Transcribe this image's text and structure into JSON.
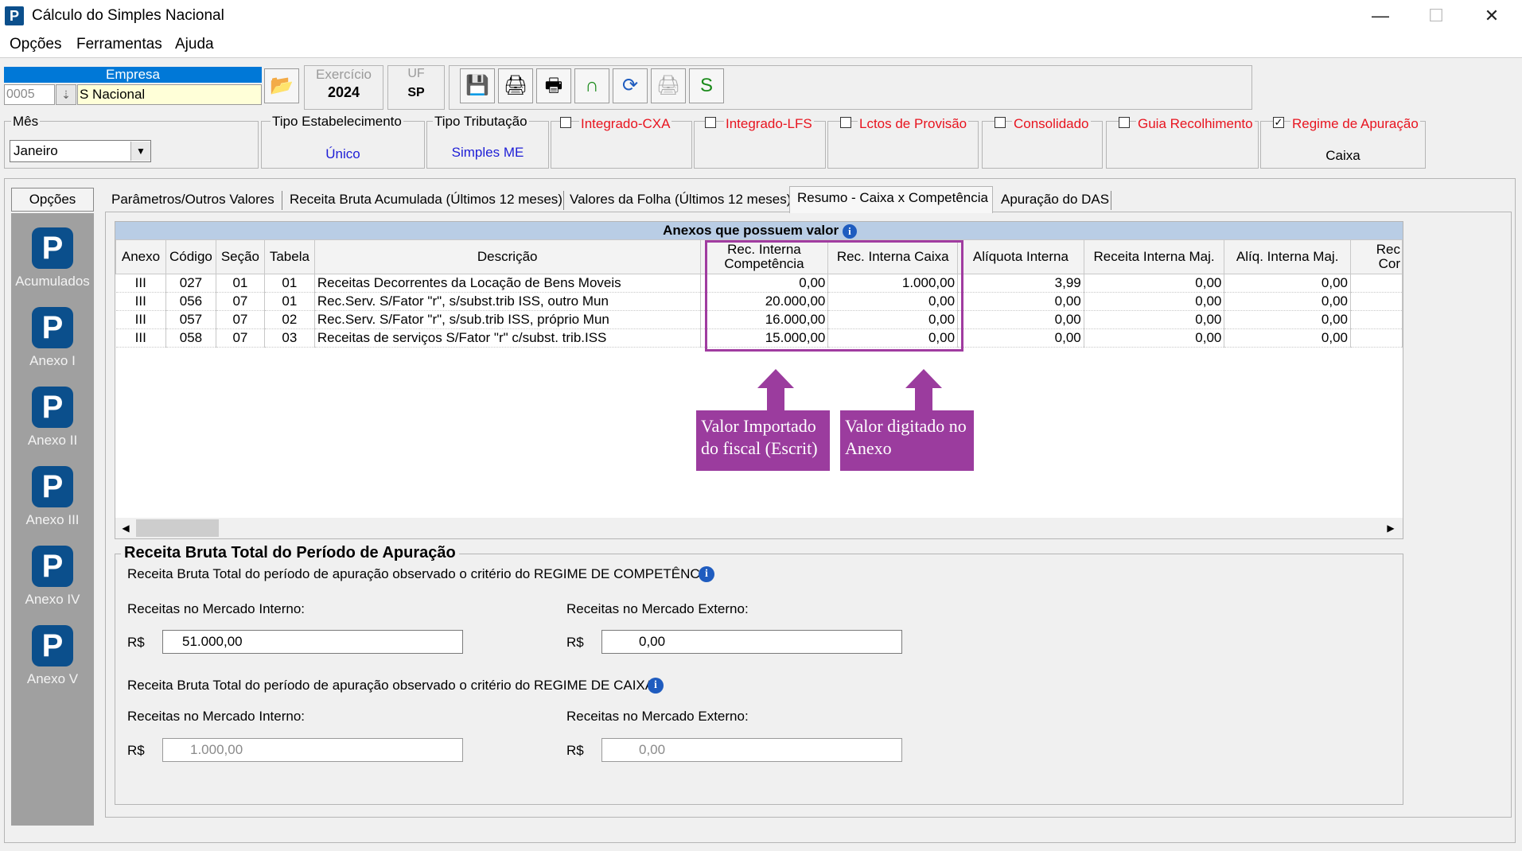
{
  "window": {
    "title": "Cálculo do Simples Nacional",
    "app_icon": "P",
    "controls": {
      "minimize": "—",
      "maximize": "☐",
      "close": "✕"
    }
  },
  "menu": [
    {
      "label": "Opções"
    },
    {
      "label": "Ferramentas"
    },
    {
      "label": "Ajuda"
    }
  ],
  "empresa": {
    "header": "Empresa",
    "code": "0005",
    "name": "S Nacional"
  },
  "exercicio": {
    "label": "Exercício",
    "value": "2024"
  },
  "uf": {
    "label": "UF",
    "value": "SP"
  },
  "toolbar_icons": [
    "save-icon",
    "print-icon",
    "print-preview-icon",
    "lock-icon",
    "refresh-icon",
    "print-disabled-icon",
    "simples-icon"
  ],
  "mes": {
    "label": "Mês",
    "value": "Janeiro"
  },
  "tipo_estabelecimento": {
    "label": "Tipo Estabelecimento",
    "value": "Único"
  },
  "tipo_tributacao": {
    "label": "Tipo Tributação",
    "value": "Simples ME"
  },
  "checks": {
    "integrado_cxa": {
      "label": "Integrado-CXA",
      "checked": false
    },
    "integrado_lfs": {
      "label": "Integrado-LFS",
      "checked": false
    },
    "lctos_provisao": {
      "label": "Lctos de Provisão",
      "checked": false
    },
    "consolidado": {
      "label": "Consolidado",
      "checked": false
    },
    "guia_recolhimento": {
      "label": "Guia Recolhimento",
      "checked": false
    },
    "regime_apuracao": {
      "label": "Regime de Apuração",
      "checked": true,
      "value": "Caixa"
    }
  },
  "side": {
    "title": "Opções",
    "items": [
      {
        "label": "Acumulados"
      },
      {
        "label": "Anexo I"
      },
      {
        "label": "Anexo II"
      },
      {
        "label": "Anexo III"
      },
      {
        "label": "Anexo IV"
      },
      {
        "label": "Anexo V"
      }
    ]
  },
  "tabs": [
    {
      "label": "Parâmetros/Outros Valores"
    },
    {
      "label": "Receita Bruta Acumulada (Últimos 12 meses)"
    },
    {
      "label": "Valores da Folha (Últimos 12 meses)"
    },
    {
      "label": "Resumo - Caixa x Competência",
      "active": true
    },
    {
      "label": "Apuração do DAS"
    }
  ],
  "grid": {
    "caption": "Anexos que possuem valor",
    "headers": [
      "Anexo",
      "Código",
      "Seção",
      "Tabela",
      "Descrição",
      "Rec. Interna\nCompetência",
      "Rec. Interna Caixa",
      "Alíquota Interna",
      "Receita Interna Maj.",
      "Alíq. Interna Maj.",
      "Rec\nCor"
    ],
    "rows": [
      [
        "III",
        "027",
        "01",
        "01",
        "Receitas Decorrentes da Locação de Bens Moveis",
        "0,00",
        "1.000,00",
        "3,99",
        "0,00",
        "0,00"
      ],
      [
        "III",
        "056",
        "07",
        "01",
        "Rec.Serv. S/Fator \"r\", s/subst.trib ISS, outro Mun",
        "20.000,00",
        "0,00",
        "0,00",
        "0,00",
        "0,00"
      ],
      [
        "III",
        "057",
        "07",
        "02",
        "Rec.Serv. S/Fator \"r\", s/sub.trib ISS, próprio Mun",
        "16.000,00",
        "0,00",
        "0,00",
        "0,00",
        "0,00"
      ],
      [
        "III",
        "058",
        "07",
        "03",
        "Receitas de serviços S/Fator \"r\" c/subst. trib.ISS",
        "15.000,00",
        "0,00",
        "0,00",
        "0,00",
        "0,00"
      ]
    ]
  },
  "callouts": {
    "left": "Valor Importado do fiscal (Escrit)",
    "right": "Valor digitado no Anexo"
  },
  "receita": {
    "title": "Receita Bruta Total do Período de Apuração",
    "competencia": {
      "label": "Receita Bruta Total do período de apuração observado o critério do REGIME DE COMPETÊNCIA",
      "interno_label": "Receitas no Mercado Interno:",
      "externo_label": "Receitas no Mercado Externo:",
      "currency": "R$",
      "interno_value": "51.000,00",
      "externo_value": "0,00"
    },
    "caixa": {
      "label": "Receita Bruta Total do período de apuração observado o critério do REGIME DE CAIXA",
      "interno_label": "Receitas no Mercado Interno:",
      "externo_label": "Receitas no Mercado Externo:",
      "currency": "R$",
      "interno_value": "1.000,00",
      "externo_value": "0,00"
    }
  },
  "colors": {
    "accent": "#0078d7",
    "highlight": "#a03ca0",
    "caption_bg": "#b9cde5",
    "red_label": "#e8141f"
  }
}
